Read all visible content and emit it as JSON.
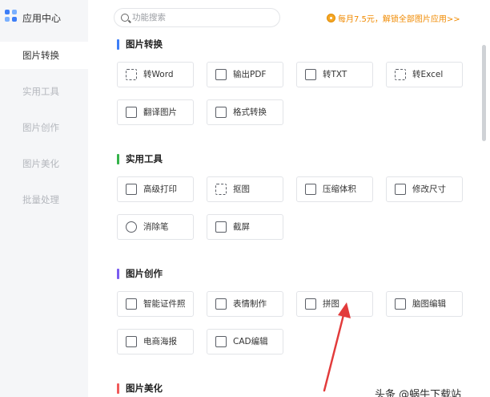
{
  "sidebar": {
    "brand_label": "应用中心",
    "items": [
      {
        "label": "图片转换",
        "active": true
      },
      {
        "label": "实用工具",
        "active": false
      },
      {
        "label": "图片创作",
        "active": false
      },
      {
        "label": "图片美化",
        "active": false
      },
      {
        "label": "批量处理",
        "active": false
      }
    ]
  },
  "search": {
    "placeholder": "功能搜索",
    "value": ""
  },
  "promo": {
    "text": "每月7.5元，解锁全部图片应用>>"
  },
  "colors": {
    "accent": "#3d7ef7",
    "promo": "#f08a00",
    "section_convert": "#3d7ef7",
    "section_tools": "#34b34a",
    "section_create": "#7a5cf0",
    "section_beautify": "#f05a5a",
    "annotation_arrow": "#e23b3b"
  },
  "sections": [
    {
      "title": "图片转换",
      "tools": [
        {
          "label": "转Word",
          "icon": "word-convert-icon"
        },
        {
          "label": "输出PDF",
          "icon": "pdf-export-icon"
        },
        {
          "label": "转TXT",
          "icon": "text-convert-icon"
        },
        {
          "label": "转Excel",
          "icon": "excel-convert-icon"
        },
        {
          "label": "翻译图片",
          "icon": "translate-icon"
        },
        {
          "label": "格式转换",
          "icon": "format-convert-icon"
        }
      ]
    },
    {
      "title": "实用工具",
      "tools": [
        {
          "label": "高级打印",
          "icon": "printer-icon"
        },
        {
          "label": "抠图",
          "icon": "cutout-icon"
        },
        {
          "label": "压缩体积",
          "icon": "compress-icon"
        },
        {
          "label": "修改尺寸",
          "icon": "resize-icon"
        },
        {
          "label": "消除笔",
          "icon": "eraser-icon"
        },
        {
          "label": "截屏",
          "icon": "screenshot-icon"
        }
      ]
    },
    {
      "title": "图片创作",
      "tools": [
        {
          "label": "智能证件照",
          "icon": "id-photo-icon"
        },
        {
          "label": "表情制作",
          "icon": "sticker-icon"
        },
        {
          "label": "拼图",
          "icon": "collage-icon"
        },
        {
          "label": "脑图编辑",
          "icon": "mindmap-icon"
        },
        {
          "label": "电商海报",
          "icon": "poster-icon"
        },
        {
          "label": "CAD编辑",
          "icon": "cad-icon"
        }
      ]
    },
    {
      "title": "图片美化",
      "tools": []
    }
  ],
  "watermark": {
    "text": "头条 @蜗牛下载站"
  }
}
